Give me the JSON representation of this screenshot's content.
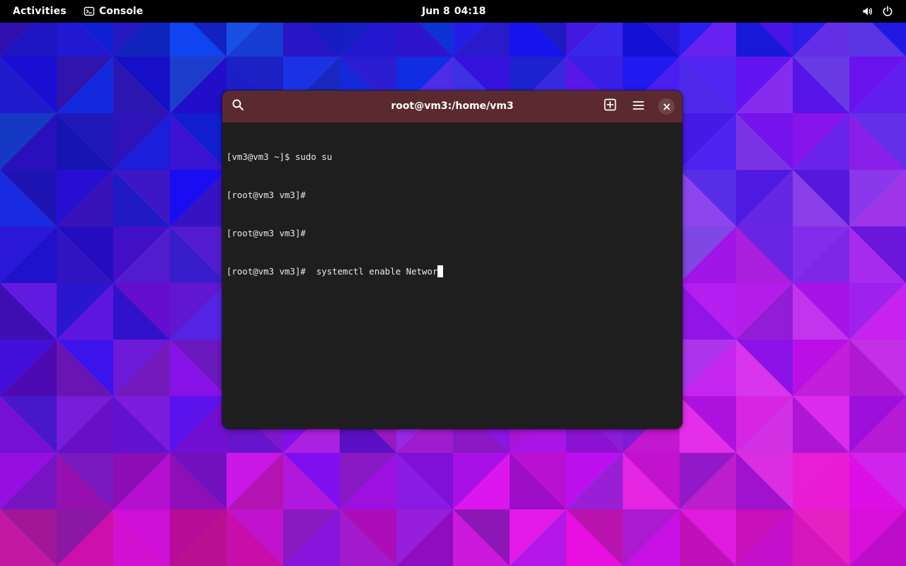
{
  "topbar": {
    "activities_label": "Activities",
    "app_name": "Console",
    "clock_date": "Jun 8",
    "clock_time": "04:18",
    "icons": [
      "console-icon",
      "volume-icon",
      "power-icon"
    ]
  },
  "window": {
    "title": "root@vm3:/home/vm3",
    "header_color": "#5a2a2e",
    "icons": [
      "search-icon",
      "new-tab-icon",
      "hamburger-menu-icon",
      "close-icon"
    ],
    "lines": [
      "[vm3@vm3 ~]$ sudo su",
      "[root@vm3 vm3]#",
      "[root@vm3 vm3]#",
      "[root@vm3 vm3]#  systemctl enable Networ"
    ]
  },
  "colors": {
    "topbar_bg": "#000000",
    "terminal_bg": "#1e1e1e",
    "terminal_fg": "#e8e8e8",
    "wallpaper_base": "#5a5fe8"
  }
}
